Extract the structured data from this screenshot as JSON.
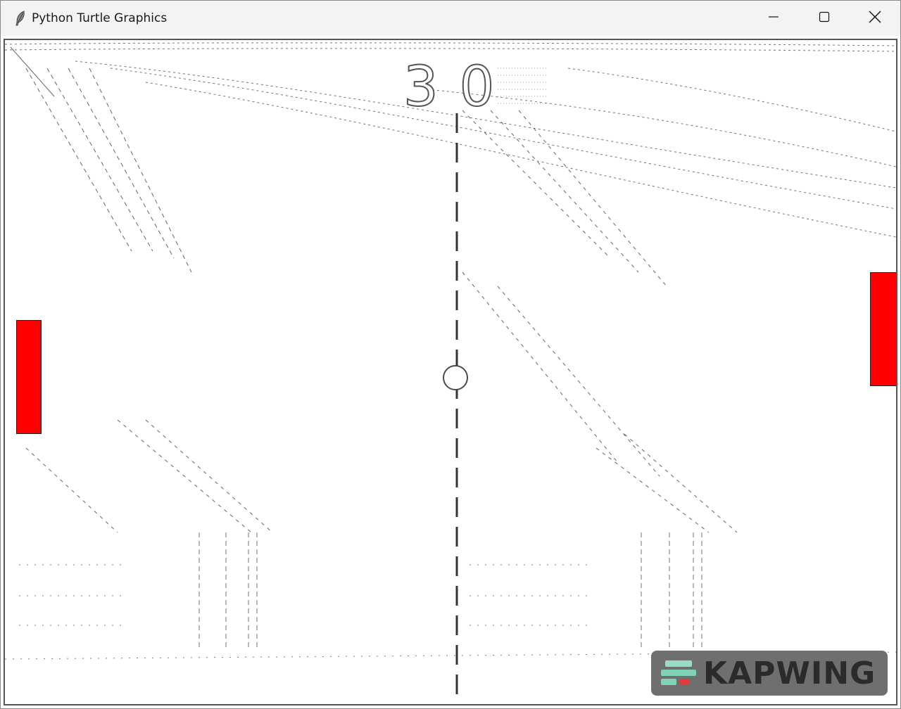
{
  "window": {
    "title": "Python Turtle Graphics",
    "icon": "feather-icon",
    "controls": [
      "minimize-icon",
      "maximize-icon",
      "close-icon"
    ]
  },
  "game": {
    "score_left": "3",
    "score_right": "0",
    "paddle_color": "#ff0000",
    "ball_color": "#ffffff"
  },
  "watermark": {
    "text": "KAPWING",
    "colors": [
      "#7fd3b4",
      "#e03c3c",
      "#9adbc6"
    ]
  }
}
